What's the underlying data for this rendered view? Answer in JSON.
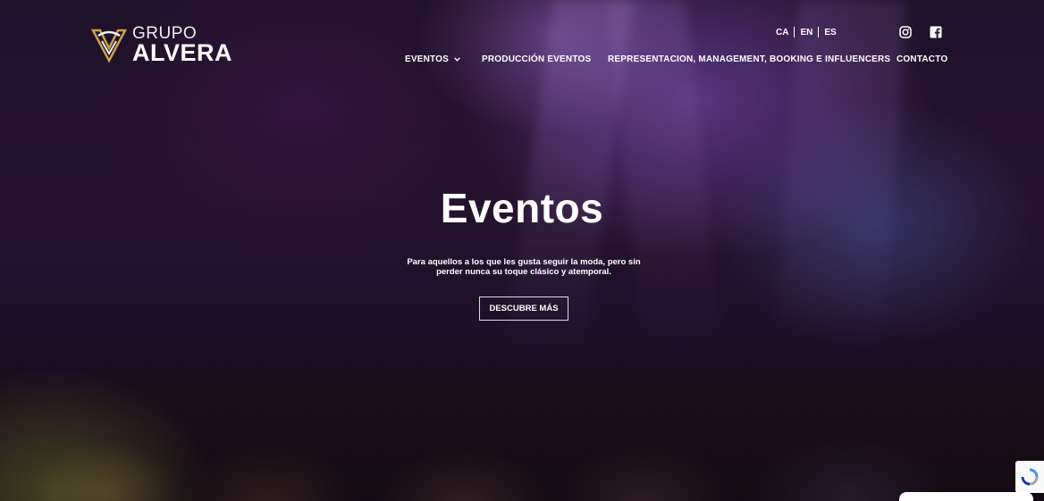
{
  "brand": {
    "top": "GRUPO",
    "bottom": "ALVERA",
    "gold": "#c9a24a"
  },
  "languages": [
    "CA",
    "EN",
    "ES"
  ],
  "social": [
    {
      "icon": "instagram-icon"
    },
    {
      "icon": "facebook-icon"
    }
  ],
  "nav": {
    "items": [
      {
        "label": "EVENTOS",
        "has_dropdown": true
      },
      {
        "label": "PRODUCCIÓN EVENTOS"
      },
      {
        "label": "REPRESENTACION, MANAGEMENT, BOOKING E INFLUENCERS"
      },
      {
        "label": "CONTACTO"
      }
    ]
  },
  "hero": {
    "title": "Eventos",
    "subtitle": "Para aquellos a los que les gusta seguir la moda, pero sin perder nunca su toque clásico y atemporal.",
    "cta": "DESCUBRE MÁS"
  },
  "colors": {
    "accent": "#9a6bff",
    "text": "#ffffff"
  }
}
